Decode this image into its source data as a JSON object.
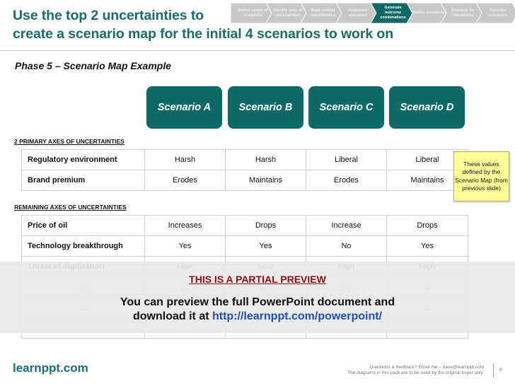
{
  "slide": {
    "title_line1": "Use the top 2 uncertainties to",
    "title_line2": "create a scenario map for the initial 4 scenarios to work on",
    "subtitle": "Phase 5 – Scenario Map Example"
  },
  "process_steps": [
    {
      "label": "Define scope of scenarios",
      "active": false
    },
    {
      "label": "Identify axes of uncertainties",
      "active": false
    },
    {
      "label": "Rank critical uncertainties",
      "active": false
    },
    {
      "label": "Determine outcomes",
      "active": false
    },
    {
      "label": "Generate outcome combinations",
      "active": true
    },
    {
      "label": "Outline scenarios",
      "active": false
    },
    {
      "label": "Checked for robustness",
      "active": false
    },
    {
      "label": "Describe scenarios",
      "active": false
    }
  ],
  "colors": {
    "accent": "#0f6a67",
    "step_inactive": "#c8c8c8",
    "title": "#1a6b6b",
    "callout": "#ffff99",
    "preview_title": "#8b1010",
    "link": "#1f4fb5"
  },
  "scenarios": [
    "Scenario A",
    "Scenario B",
    "Scenario C",
    "Scenario D"
  ],
  "primary": {
    "heading": "2 PRIMARY AXES OF UNCERTAINTIES",
    "rows": [
      {
        "label": "Regulatory environment",
        "values": [
          "Harsh",
          "Harsh",
          "Liberal",
          "Liberal"
        ]
      },
      {
        "label": "Brand premium",
        "values": [
          "Erodes",
          "Maintains",
          "Erodes",
          "Maintains"
        ]
      }
    ]
  },
  "remaining": {
    "heading": "REMAINING AXES OF UNCERTAINTIES",
    "rows": [
      {
        "label": "Price of oil",
        "values": [
          "Increases",
          "Drops",
          "Increase",
          "Drops"
        ]
      },
      {
        "label": "Technology breakthrough",
        "values": [
          "Yes",
          "Yes",
          "No",
          "Yes"
        ]
      },
      {
        "label": "Threat of digitization",
        "values": [
          "High",
          "Low",
          "High",
          "High"
        ]
      },
      {
        "label": "…",
        "values": [
          "…",
          "…",
          "…",
          "…"
        ]
      },
      {
        "label": "…",
        "values": [
          "…",
          "…",
          "…",
          "…"
        ]
      },
      {
        "label": "…",
        "values": [
          "…",
          "…",
          "…",
          "…"
        ]
      }
    ]
  },
  "callout": {
    "text": "These values defined by the Scenario Map (from previous slide)"
  },
  "preview": {
    "title": "THIS IS A PARTIAL PREVIEW",
    "line1": "You can preview the full PowerPoint document and",
    "line2_prefix": "download it at ",
    "link": "http://learnppt.com/powerpoint/"
  },
  "footer": {
    "brand": "learnppt.com",
    "line1": "Questions & feedback?  Email me – dave@learnppt.com",
    "line2": "The diagrams in this pack are to be used by the original buyer only.",
    "page": "6"
  }
}
